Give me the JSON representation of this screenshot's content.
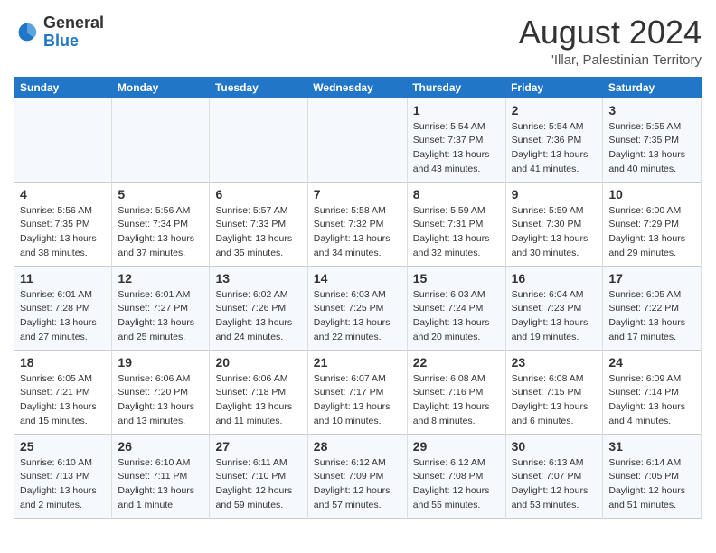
{
  "logo": {
    "general": "General",
    "blue": "Blue"
  },
  "header": {
    "month_year": "August 2024",
    "location": "'Illar, Palestinian Territory"
  },
  "days_of_week": [
    "Sunday",
    "Monday",
    "Tuesday",
    "Wednesday",
    "Thursday",
    "Friday",
    "Saturday"
  ],
  "weeks": [
    [
      {
        "day": "",
        "info": ""
      },
      {
        "day": "",
        "info": ""
      },
      {
        "day": "",
        "info": ""
      },
      {
        "day": "",
        "info": ""
      },
      {
        "day": "1",
        "info": "Sunrise: 5:54 AM\nSunset: 7:37 PM\nDaylight: 13 hours\nand 43 minutes."
      },
      {
        "day": "2",
        "info": "Sunrise: 5:54 AM\nSunset: 7:36 PM\nDaylight: 13 hours\nand 41 minutes."
      },
      {
        "day": "3",
        "info": "Sunrise: 5:55 AM\nSunset: 7:35 PM\nDaylight: 13 hours\nand 40 minutes."
      }
    ],
    [
      {
        "day": "4",
        "info": "Sunrise: 5:56 AM\nSunset: 7:35 PM\nDaylight: 13 hours\nand 38 minutes."
      },
      {
        "day": "5",
        "info": "Sunrise: 5:56 AM\nSunset: 7:34 PM\nDaylight: 13 hours\nand 37 minutes."
      },
      {
        "day": "6",
        "info": "Sunrise: 5:57 AM\nSunset: 7:33 PM\nDaylight: 13 hours\nand 35 minutes."
      },
      {
        "day": "7",
        "info": "Sunrise: 5:58 AM\nSunset: 7:32 PM\nDaylight: 13 hours\nand 34 minutes."
      },
      {
        "day": "8",
        "info": "Sunrise: 5:59 AM\nSunset: 7:31 PM\nDaylight: 13 hours\nand 32 minutes."
      },
      {
        "day": "9",
        "info": "Sunrise: 5:59 AM\nSunset: 7:30 PM\nDaylight: 13 hours\nand 30 minutes."
      },
      {
        "day": "10",
        "info": "Sunrise: 6:00 AM\nSunset: 7:29 PM\nDaylight: 13 hours\nand 29 minutes."
      }
    ],
    [
      {
        "day": "11",
        "info": "Sunrise: 6:01 AM\nSunset: 7:28 PM\nDaylight: 13 hours\nand 27 minutes."
      },
      {
        "day": "12",
        "info": "Sunrise: 6:01 AM\nSunset: 7:27 PM\nDaylight: 13 hours\nand 25 minutes."
      },
      {
        "day": "13",
        "info": "Sunrise: 6:02 AM\nSunset: 7:26 PM\nDaylight: 13 hours\nand 24 minutes."
      },
      {
        "day": "14",
        "info": "Sunrise: 6:03 AM\nSunset: 7:25 PM\nDaylight: 13 hours\nand 22 minutes."
      },
      {
        "day": "15",
        "info": "Sunrise: 6:03 AM\nSunset: 7:24 PM\nDaylight: 13 hours\nand 20 minutes."
      },
      {
        "day": "16",
        "info": "Sunrise: 6:04 AM\nSunset: 7:23 PM\nDaylight: 13 hours\nand 19 minutes."
      },
      {
        "day": "17",
        "info": "Sunrise: 6:05 AM\nSunset: 7:22 PM\nDaylight: 13 hours\nand 17 minutes."
      }
    ],
    [
      {
        "day": "18",
        "info": "Sunrise: 6:05 AM\nSunset: 7:21 PM\nDaylight: 13 hours\nand 15 minutes."
      },
      {
        "day": "19",
        "info": "Sunrise: 6:06 AM\nSunset: 7:20 PM\nDaylight: 13 hours\nand 13 minutes."
      },
      {
        "day": "20",
        "info": "Sunrise: 6:06 AM\nSunset: 7:18 PM\nDaylight: 13 hours\nand 11 minutes."
      },
      {
        "day": "21",
        "info": "Sunrise: 6:07 AM\nSunset: 7:17 PM\nDaylight: 13 hours\nand 10 minutes."
      },
      {
        "day": "22",
        "info": "Sunrise: 6:08 AM\nSunset: 7:16 PM\nDaylight: 13 hours\nand 8 minutes."
      },
      {
        "day": "23",
        "info": "Sunrise: 6:08 AM\nSunset: 7:15 PM\nDaylight: 13 hours\nand 6 minutes."
      },
      {
        "day": "24",
        "info": "Sunrise: 6:09 AM\nSunset: 7:14 PM\nDaylight: 13 hours\nand 4 minutes."
      }
    ],
    [
      {
        "day": "25",
        "info": "Sunrise: 6:10 AM\nSunset: 7:13 PM\nDaylight: 13 hours\nand 2 minutes."
      },
      {
        "day": "26",
        "info": "Sunrise: 6:10 AM\nSunset: 7:11 PM\nDaylight: 13 hours\nand 1 minute."
      },
      {
        "day": "27",
        "info": "Sunrise: 6:11 AM\nSunset: 7:10 PM\nDaylight: 12 hours\nand 59 minutes."
      },
      {
        "day": "28",
        "info": "Sunrise: 6:12 AM\nSunset: 7:09 PM\nDaylight: 12 hours\nand 57 minutes."
      },
      {
        "day": "29",
        "info": "Sunrise: 6:12 AM\nSunset: 7:08 PM\nDaylight: 12 hours\nand 55 minutes."
      },
      {
        "day": "30",
        "info": "Sunrise: 6:13 AM\nSunset: 7:07 PM\nDaylight: 12 hours\nand 53 minutes."
      },
      {
        "day": "31",
        "info": "Sunrise: 6:14 AM\nSunset: 7:05 PM\nDaylight: 12 hours\nand 51 minutes."
      }
    ]
  ]
}
